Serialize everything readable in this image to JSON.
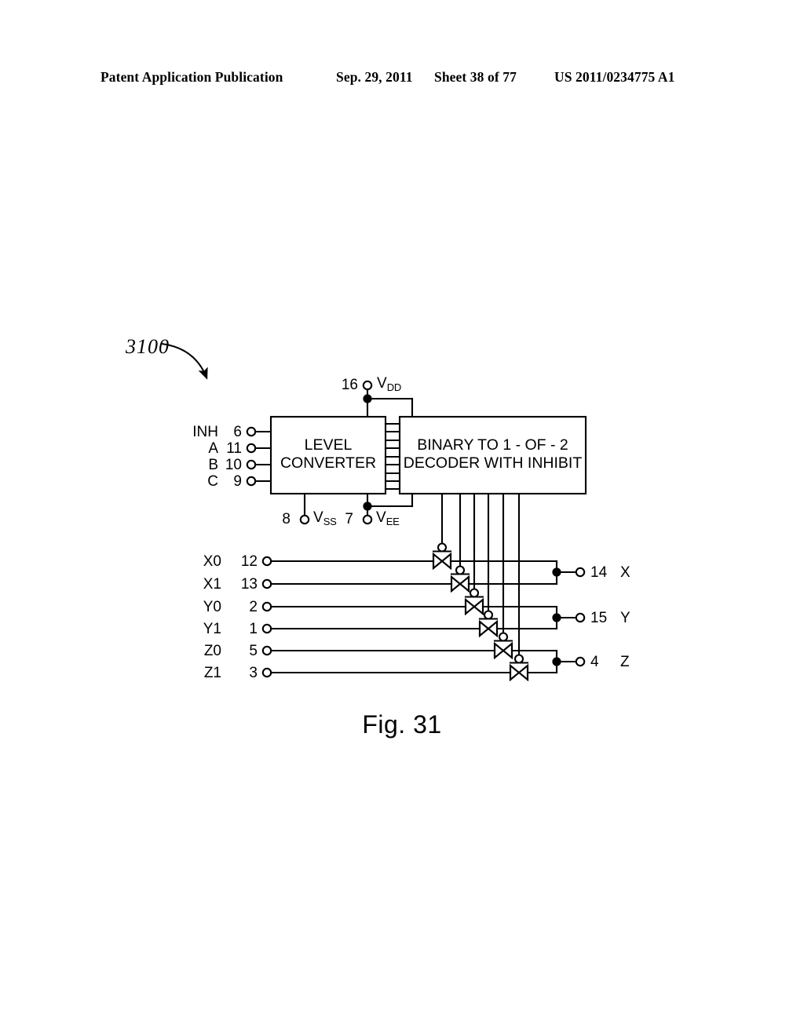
{
  "header": {
    "publication": "Patent Application Publication",
    "date": "Sep. 29, 2011",
    "sheet": "Sheet 38 of 77",
    "patent_number": "US 2011/0234775 A1"
  },
  "figure": {
    "caption": "Fig. 31",
    "reference_numeral": "3100",
    "blocks": [
      {
        "id": "level-converter",
        "line1": "LEVEL",
        "line2": "CONVERTER"
      },
      {
        "id": "decoder",
        "line1": "BINARY TO 1 - OF - 2",
        "line2": "DECODER WITH INHIBIT"
      }
    ],
    "control_inputs": [
      {
        "name": "INH",
        "pin": "6"
      },
      {
        "name": "A",
        "pin": "11"
      },
      {
        "name": "B",
        "pin": "10"
      },
      {
        "name": "C",
        "pin": "9"
      }
    ],
    "supplies": [
      {
        "pin": "16",
        "name": "V",
        "subscript": "DD"
      },
      {
        "pin": "8",
        "name": "V",
        "subscript": "SS"
      },
      {
        "pin": "7",
        "name": "V",
        "subscript": "EE"
      }
    ],
    "switch_inputs": [
      {
        "name": "X0",
        "pin": "12"
      },
      {
        "name": "X1",
        "pin": "13"
      },
      {
        "name": "Y0",
        "pin": "2"
      },
      {
        "name": "Y1",
        "pin": "1"
      },
      {
        "name": "Z0",
        "pin": "5"
      },
      {
        "name": "Z1",
        "pin": "3"
      }
    ],
    "switch_outputs": [
      {
        "pin": "14",
        "name": "X"
      },
      {
        "pin": "15",
        "name": "Y"
      },
      {
        "pin": "4",
        "name": "Z"
      }
    ]
  }
}
